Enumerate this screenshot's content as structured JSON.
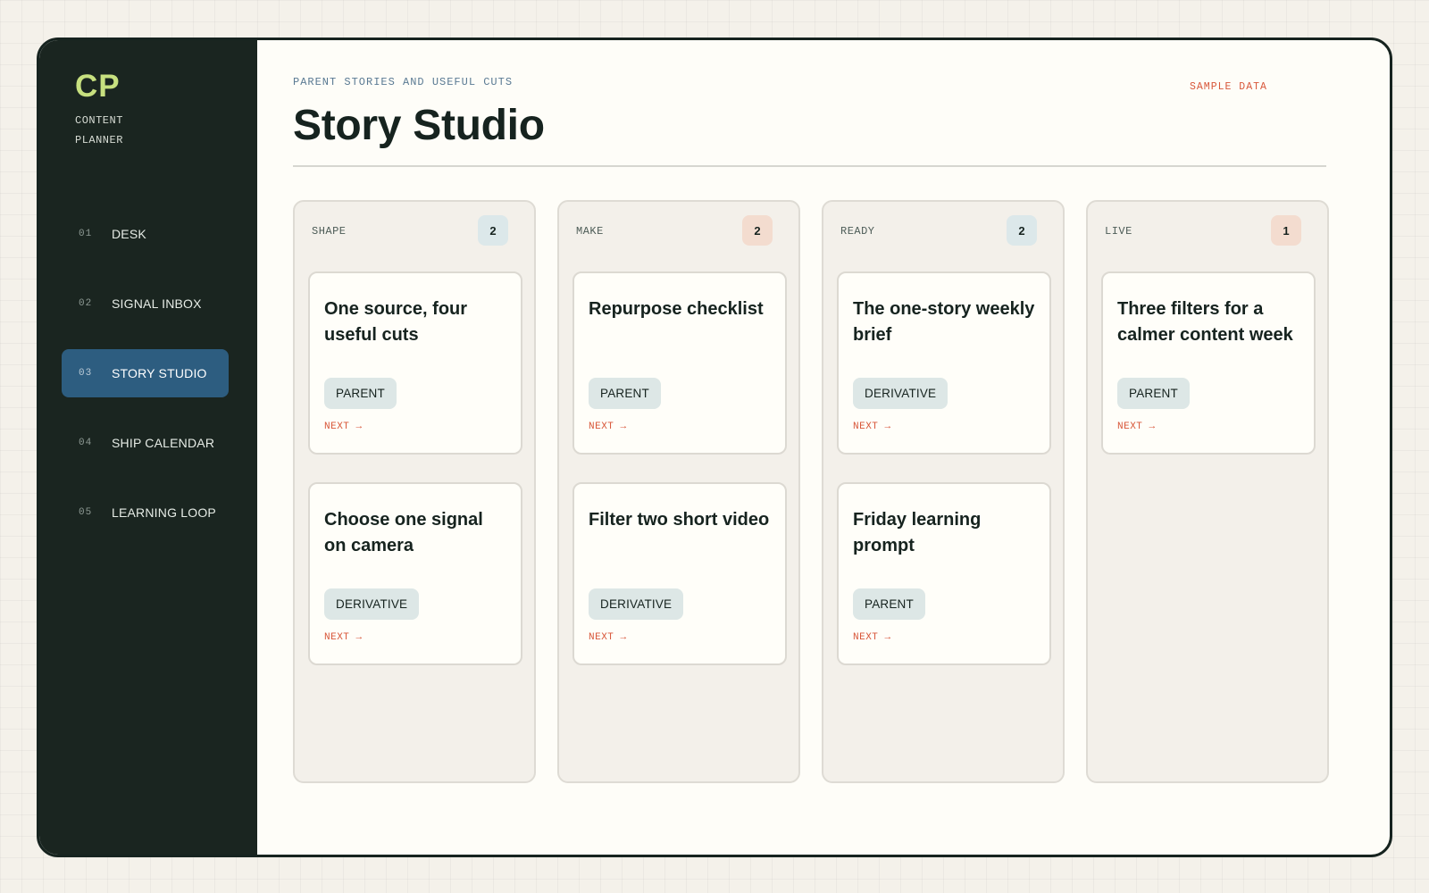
{
  "sidebar": {
    "brand": "CP",
    "subtitle_line1": "CONTENT",
    "subtitle_line2": "PLANNER",
    "items": [
      {
        "num": "01",
        "label": "DESK",
        "active": false
      },
      {
        "num": "02",
        "label": "SIGNAL INBOX",
        "active": false
      },
      {
        "num": "03",
        "label": "STORY STUDIO",
        "active": true
      },
      {
        "num": "04",
        "label": "SHIP CALENDAR",
        "active": false
      },
      {
        "num": "05",
        "label": "LEARNING LOOP",
        "active": false
      }
    ]
  },
  "header": {
    "eyebrow": "PARENT STORIES AND USEFUL CUTS",
    "title": "Story Studio",
    "sample_tag": "SAMPLE DATA"
  },
  "colors": {
    "sidebar_bg": "#1a2520",
    "accent_lime": "#c7e07f",
    "active_nav": "#2d5d80",
    "next_link": "#d8573a",
    "count_cool": "#dce8ea",
    "count_warm": "#f3dccf",
    "tag_bg": "#dde7e6"
  },
  "board": {
    "columns": [
      {
        "name": "SHAPE",
        "count": "2",
        "count_tone": "cool",
        "cards": [
          {
            "title": "One source, four useful cuts",
            "tag": "PARENT",
            "next": "NEXT →"
          },
          {
            "title": "Choose one signal on camera",
            "tag": "DERIVATIVE",
            "next": "NEXT →"
          }
        ]
      },
      {
        "name": "MAKE",
        "count": "2",
        "count_tone": "warm",
        "cards": [
          {
            "title": "Repurpose checklist",
            "tag": "PARENT",
            "next": "NEXT →"
          },
          {
            "title": "Filter two short video",
            "tag": "DERIVATIVE",
            "next": "NEXT →"
          }
        ]
      },
      {
        "name": "READY",
        "count": "2",
        "count_tone": "cool",
        "cards": [
          {
            "title": "The one-story weekly brief",
            "tag": "DERIVATIVE",
            "next": "NEXT →"
          },
          {
            "title": "Friday learning prompt",
            "tag": "PARENT",
            "next": "NEXT →"
          }
        ]
      },
      {
        "name": "LIVE",
        "count": "1",
        "count_tone": "warm",
        "cards": [
          {
            "title": "Three filters for a calmer content week",
            "tag": "PARENT",
            "next": "NEXT →"
          }
        ]
      }
    ]
  }
}
